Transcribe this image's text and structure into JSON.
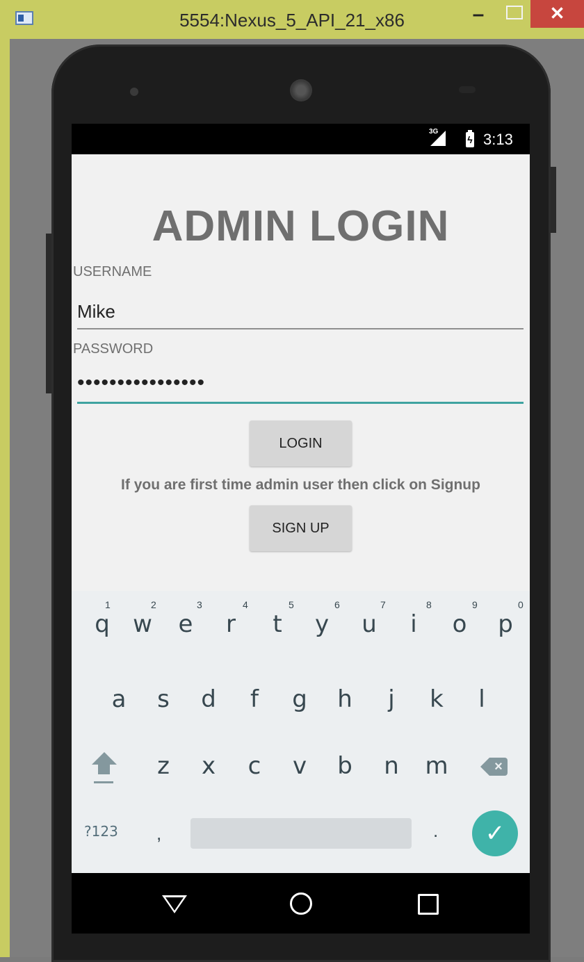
{
  "window": {
    "title": "5554:Nexus_5_API_21_x86",
    "minimize": "–",
    "close": "✕"
  },
  "status_bar": {
    "network": "3G",
    "time": "3:13"
  },
  "app": {
    "title": "ADMIN LOGIN",
    "username_label": "USERNAME",
    "username_value": "Mike",
    "password_label": "PASSWORD",
    "password_value": "••••••••••••••••",
    "login_button": "LOGIN",
    "hint": "If you are first time admin user then click on Signup",
    "signup_button": "SIGN UP"
  },
  "keyboard": {
    "row1": [
      "q",
      "w",
      "e",
      "r",
      "t",
      "y",
      "u",
      "i",
      "o",
      "p"
    ],
    "row1_hints": [
      "1",
      "2",
      "3",
      "4",
      "5",
      "6",
      "7",
      "8",
      "9",
      "0"
    ],
    "row2": [
      "a",
      "s",
      "d",
      "f",
      "g",
      "h",
      "j",
      "k",
      "l"
    ],
    "row3": [
      "z",
      "x",
      "c",
      "v",
      "b",
      "n",
      "m"
    ],
    "symbols_key": "?123",
    "comma": ",",
    "period": ".",
    "enter_icon": "✓",
    "shift_icon": "shift-icon",
    "backspace_icon": "backspace-icon"
  },
  "colors": {
    "accent": "#3fa3a0",
    "enter_key": "#3fb3a9",
    "title_gray": "#6f6f6f"
  }
}
